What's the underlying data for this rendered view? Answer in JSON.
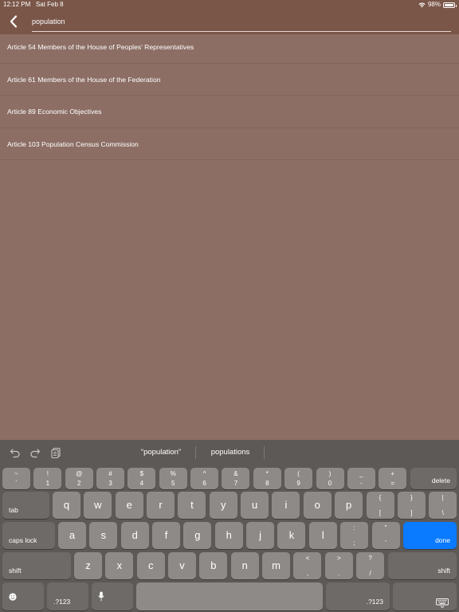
{
  "status_bar": {
    "time": "12:12 PM",
    "date": "Sat Feb 8",
    "battery": "98%",
    "battery_level": 0.98
  },
  "search": {
    "value": "population"
  },
  "results": [
    "Article 54 Members of the House of Peoples' Representatives",
    "Article 61 Members of the House of the Federation",
    "Article 89 Economic Objectives",
    "Article 103 Population Census Commission"
  ],
  "keyboard": {
    "suggestions": [
      "“population”",
      "populations"
    ],
    "number_row": [
      {
        "top": "~",
        "bottom": "`"
      },
      {
        "top": "!",
        "bottom": "1"
      },
      {
        "top": "@",
        "bottom": "2"
      },
      {
        "top": "#",
        "bottom": "3"
      },
      {
        "top": "$",
        "bottom": "4"
      },
      {
        "top": "%",
        "bottom": "5"
      },
      {
        "top": "^",
        "bottom": "6"
      },
      {
        "top": "&",
        "bottom": "7"
      },
      {
        "top": "*",
        "bottom": "8"
      },
      {
        "top": "(",
        "bottom": "9"
      },
      {
        "top": ")",
        "bottom": "0"
      },
      {
        "top": "_",
        "bottom": "-"
      },
      {
        "top": "+",
        "bottom": "="
      }
    ],
    "delete_label": "delete",
    "tab_label": "tab",
    "row_q": [
      "q",
      "w",
      "e",
      "r",
      "t",
      "y",
      "u",
      "i",
      "o",
      "p"
    ],
    "row_q_symbols": [
      {
        "top": "{",
        "bottom": "["
      },
      {
        "top": "}",
        "bottom": "]"
      },
      {
        "top": "|",
        "bottom": "\\"
      }
    ],
    "caps_label": "caps lock",
    "row_a": [
      "a",
      "s",
      "d",
      "f",
      "g",
      "h",
      "j",
      "k",
      "l"
    ],
    "row_a_symbols": [
      {
        "top": ":",
        "bottom": ";"
      },
      {
        "top": "\"",
        "bottom": "'"
      }
    ],
    "done_label": "done",
    "shift_label": "shift",
    "row_z": [
      "z",
      "x",
      "c",
      "v",
      "b",
      "n",
      "m"
    ],
    "row_z_symbols": [
      {
        "top": "<",
        "bottom": ","
      },
      {
        "top": ">",
        "bottom": "."
      },
      {
        "top": "?",
        "bottom": "/"
      }
    ],
    "numbers_label": ".?123"
  },
  "colors": {
    "header": "#7a5648",
    "background": "#8c6e64",
    "keyboard": "#5d5956",
    "key": "#8e8a87",
    "done": "#0a7aff"
  }
}
